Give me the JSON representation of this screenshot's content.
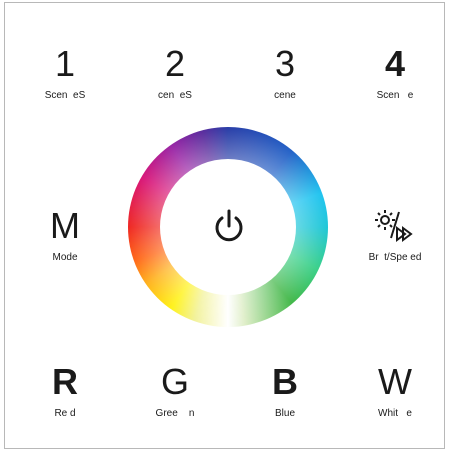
{
  "scenes": [
    {
      "number": "1",
      "label": "Scen  eS"
    },
    {
      "number": "2",
      "label": "cen  eS"
    },
    {
      "number": "3",
      "label": "cene"
    },
    {
      "number": "4",
      "label": "Scen   e"
    }
  ],
  "mode": {
    "letter": "M",
    "label": "Mode"
  },
  "brightness_speed": {
    "label": "Br  t/Spe ed"
  },
  "colors": [
    {
      "letter": "R",
      "label": "Re d"
    },
    {
      "letter": "G",
      "label": "Gree    n"
    },
    {
      "letter": "B",
      "label": "Blue"
    },
    {
      "letter": "W",
      "label": "Whit   e"
    }
  ]
}
